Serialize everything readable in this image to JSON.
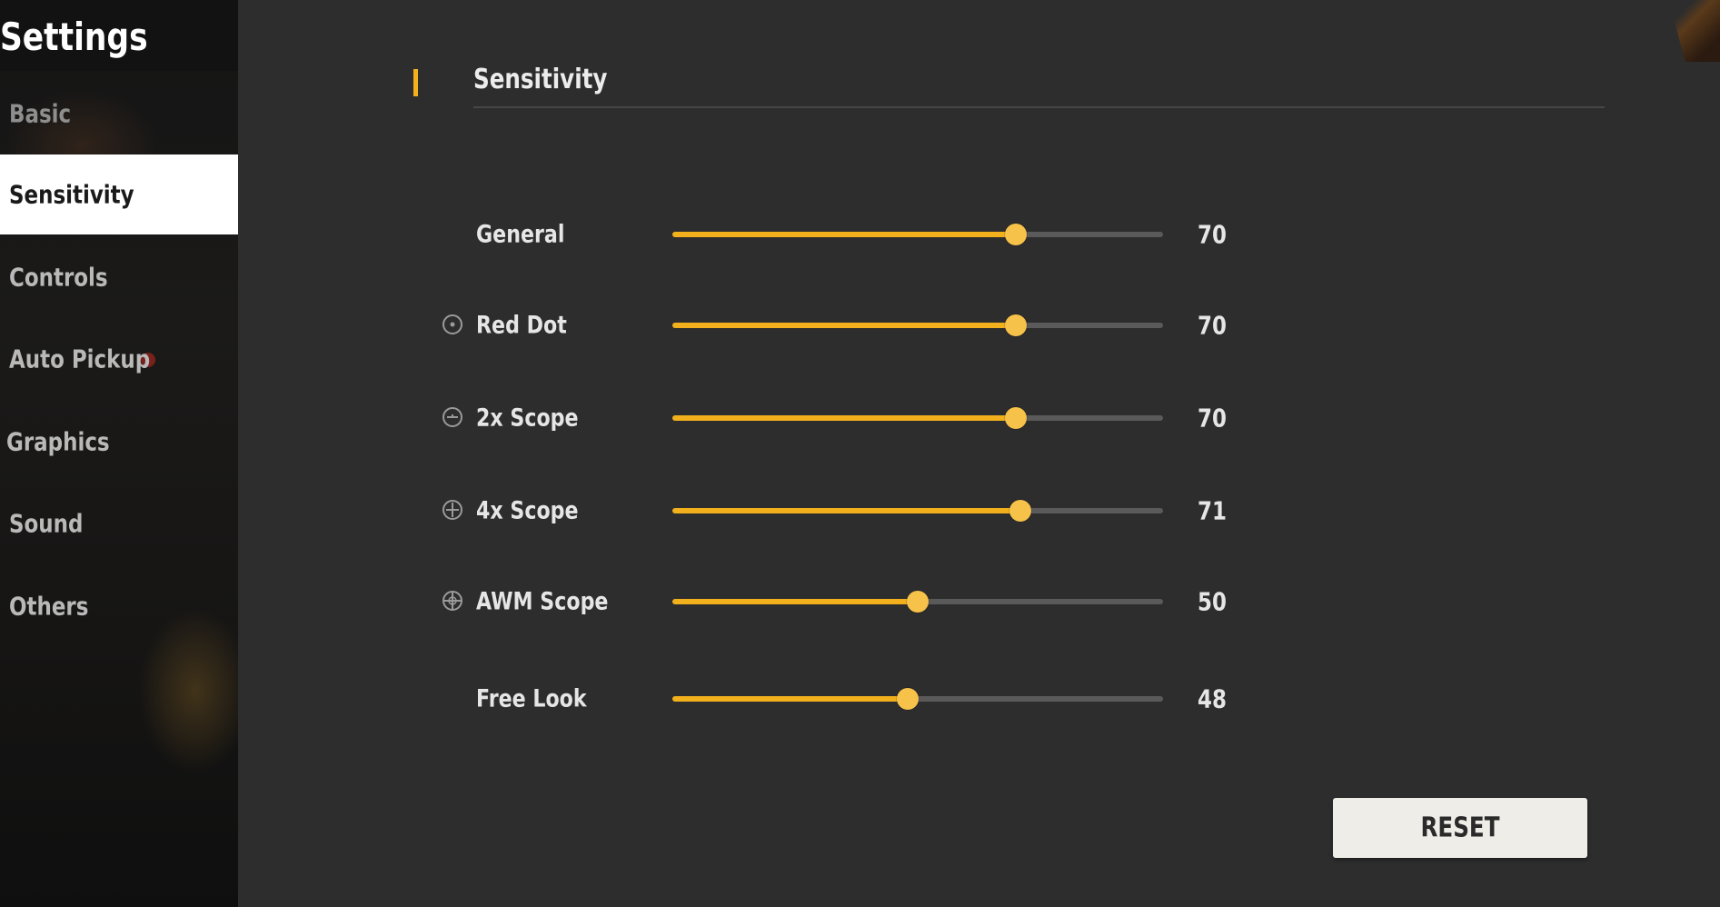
{
  "sidebar": {
    "title": "Settings",
    "items": [
      {
        "label": "Basic",
        "active": false
      },
      {
        "label": "Sensitivity",
        "active": true
      },
      {
        "label": "Controls",
        "active": false
      },
      {
        "label": "Auto Pickup",
        "active": false
      },
      {
        "label": "Graphics",
        "active": false
      },
      {
        "label": "Sound",
        "active": false
      },
      {
        "label": "Others",
        "active": false
      }
    ]
  },
  "section": {
    "title": "Sensitivity"
  },
  "sliders": [
    {
      "label": "General",
      "value": "70",
      "fraction": 0.7,
      "icon": ""
    },
    {
      "label": "Red Dot",
      "value": "70",
      "fraction": 0.7,
      "icon": "red-dot-icon"
    },
    {
      "label": "2x Scope",
      "value": "70",
      "fraction": 0.7,
      "icon": "2x-scope-icon"
    },
    {
      "label": "4x Scope",
      "value": "71",
      "fraction": 0.71,
      "icon": "4x-scope-icon"
    },
    {
      "label": "AWM Scope",
      "value": "50",
      "fraction": 0.5,
      "icon": "awm-scope-icon"
    },
    {
      "label": "Free Look",
      "value": "48",
      "fraction": 0.48,
      "icon": ""
    }
  ],
  "reset_label": "RESET",
  "colors": {
    "accent": "#f2b11c",
    "knob": "#f7c24a",
    "panel": "#2d2d2d",
    "active_nav": "#ffffff"
  }
}
